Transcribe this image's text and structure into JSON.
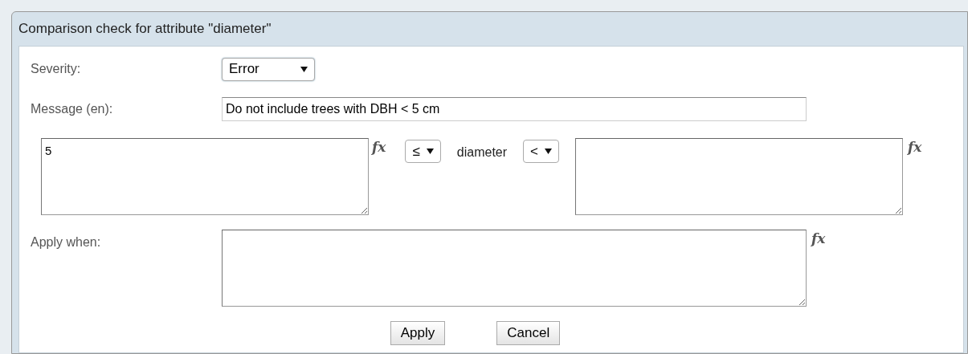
{
  "dialog": {
    "title": "Comparison check for attribute \"diameter\""
  },
  "severity": {
    "label": "Severity:",
    "value": "Error"
  },
  "message": {
    "label": "Message (en):",
    "value": "Do not include trees with DBH < 5 cm"
  },
  "comparison": {
    "left_value": "5",
    "left_fx": "fx",
    "left_operator": "≤",
    "attribute": "diameter",
    "right_operator": "<",
    "right_fx": "fx"
  },
  "apply_when": {
    "label": "Apply when:",
    "fx": "fx"
  },
  "buttons": [
    "Apply",
    "Cancel"
  ]
}
